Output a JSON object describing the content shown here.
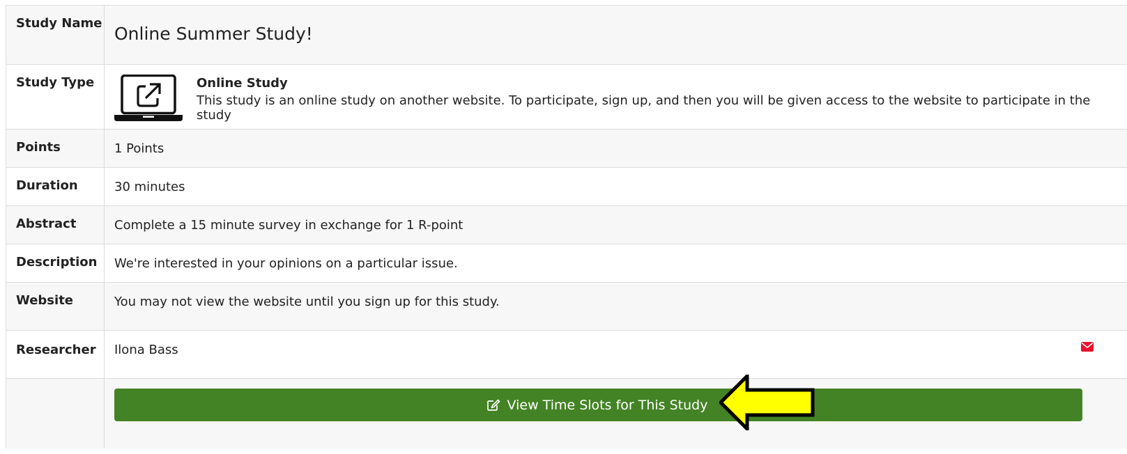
{
  "rows": {
    "study_name": {
      "label": "Study Name",
      "value": "Online Summer Study!"
    },
    "study_type": {
      "label": "Study Type",
      "icon": "laptop-external-link-icon",
      "title": "Online Study",
      "description": "This study is an online study on another website. To participate, sign up, and then you will be given access to the website to participate in the study"
    },
    "points": {
      "label": "Points",
      "value": "1 Points"
    },
    "duration": {
      "label": "Duration",
      "value": "30 minutes"
    },
    "abstract": {
      "label": "Abstract",
      "value": "Complete a 15 minute survey in exchange for 1 R-point"
    },
    "description": {
      "label": "Description",
      "value": "We're interested in your opinions on a particular issue."
    },
    "website": {
      "label": "Website",
      "value": "You may not view the website until you sign up for this study."
    },
    "researcher": {
      "label": "Researcher",
      "value": "Ilona Bass",
      "icon": "envelope-icon"
    }
  },
  "action": {
    "label": "View Time Slots for This Study",
    "icon": "edit-icon"
  },
  "annotation": {
    "icon": "yellow-arrow-icon"
  },
  "colors": {
    "button": "#438325",
    "mail_icon": "#e8132e",
    "arrow_fill": "#ffff00",
    "row_shade": "#f7f7f7",
    "border": "#dcdcdc"
  }
}
